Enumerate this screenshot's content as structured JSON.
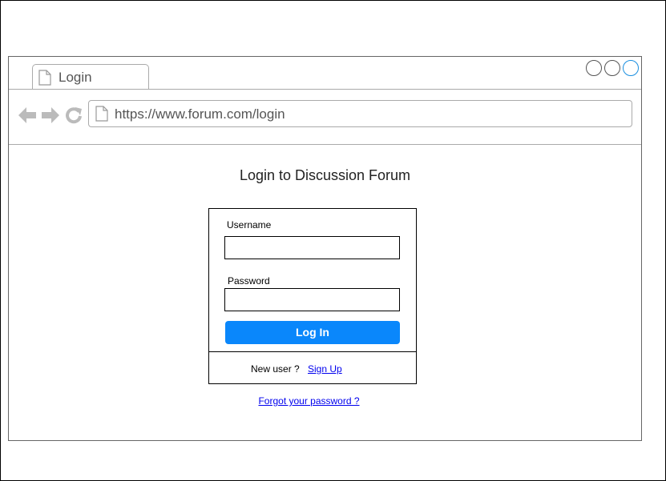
{
  "browser": {
    "tab": {
      "label": "Login"
    },
    "url": "https://www.forum.com/login"
  },
  "page": {
    "title": "Login to Discussion Forum",
    "form": {
      "username_label": "Username",
      "username_value": "",
      "password_label": "Password",
      "password_value": "",
      "login_button": "Log In",
      "new_user_text": "New user ?",
      "signup_link": "Sign Up"
    },
    "forgot_link": "Forgot your password ?"
  },
  "colors": {
    "accent": "#0a87fb",
    "link": "#0000ee",
    "maximize_control": "#1a8fe0"
  },
  "icons": [
    "page-icon",
    "back-arrow-icon",
    "forward-arrow-icon",
    "refresh-icon"
  ]
}
